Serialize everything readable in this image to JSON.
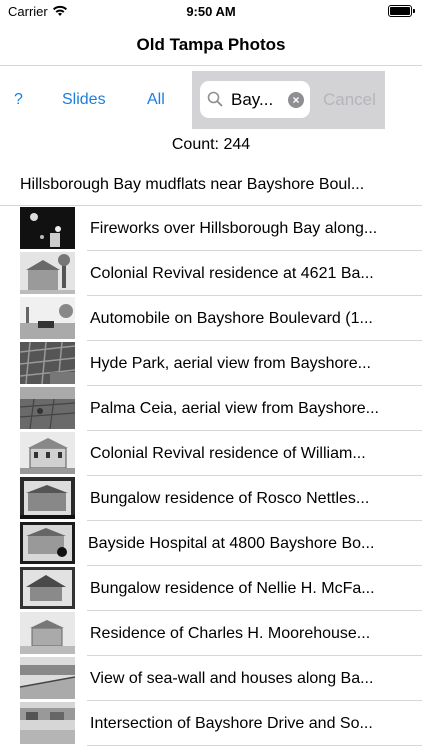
{
  "status": {
    "carrier": "Carrier",
    "time": "9:50 AM"
  },
  "nav": {
    "title": "Old Tampa Photos"
  },
  "toolbar": {
    "help_label": "?",
    "slides_label": "Slides",
    "all_label": "All",
    "search_value": "Bay...",
    "cancel_label": "Cancel"
  },
  "count_text": "Count: 244",
  "first_item": "Hillsborough Bay mudflats near Bayshore Boul...",
  "items": [
    {
      "title": "Fireworks over Hillsborough Bay along..."
    },
    {
      "title": "Colonial Revival residence at 4621 Ba..."
    },
    {
      "title": "Automobile on Bayshore Boulevard (1..."
    },
    {
      "title": "Hyde Park, aerial view from Bayshore..."
    },
    {
      "title": "Palma Ceia, aerial view from Bayshore..."
    },
    {
      "title": "Colonial Revival residence of William..."
    },
    {
      "title": "Bungalow residence of Rosco Nettles..."
    },
    {
      "title": "Bayside Hospital at 4800 Bayshore Bo..."
    },
    {
      "title": "Bungalow residence of Nellie H. McFa..."
    },
    {
      "title": "Residence of Charles H. Moorehouse..."
    },
    {
      "title": "View of sea-wall and houses along Ba..."
    },
    {
      "title": "Intersection of Bayshore Drive and So..."
    }
  ],
  "colors": {
    "accent": "#1a7fe0",
    "search_bg": "#d3d3d6",
    "separator": "#d6d6d6"
  }
}
